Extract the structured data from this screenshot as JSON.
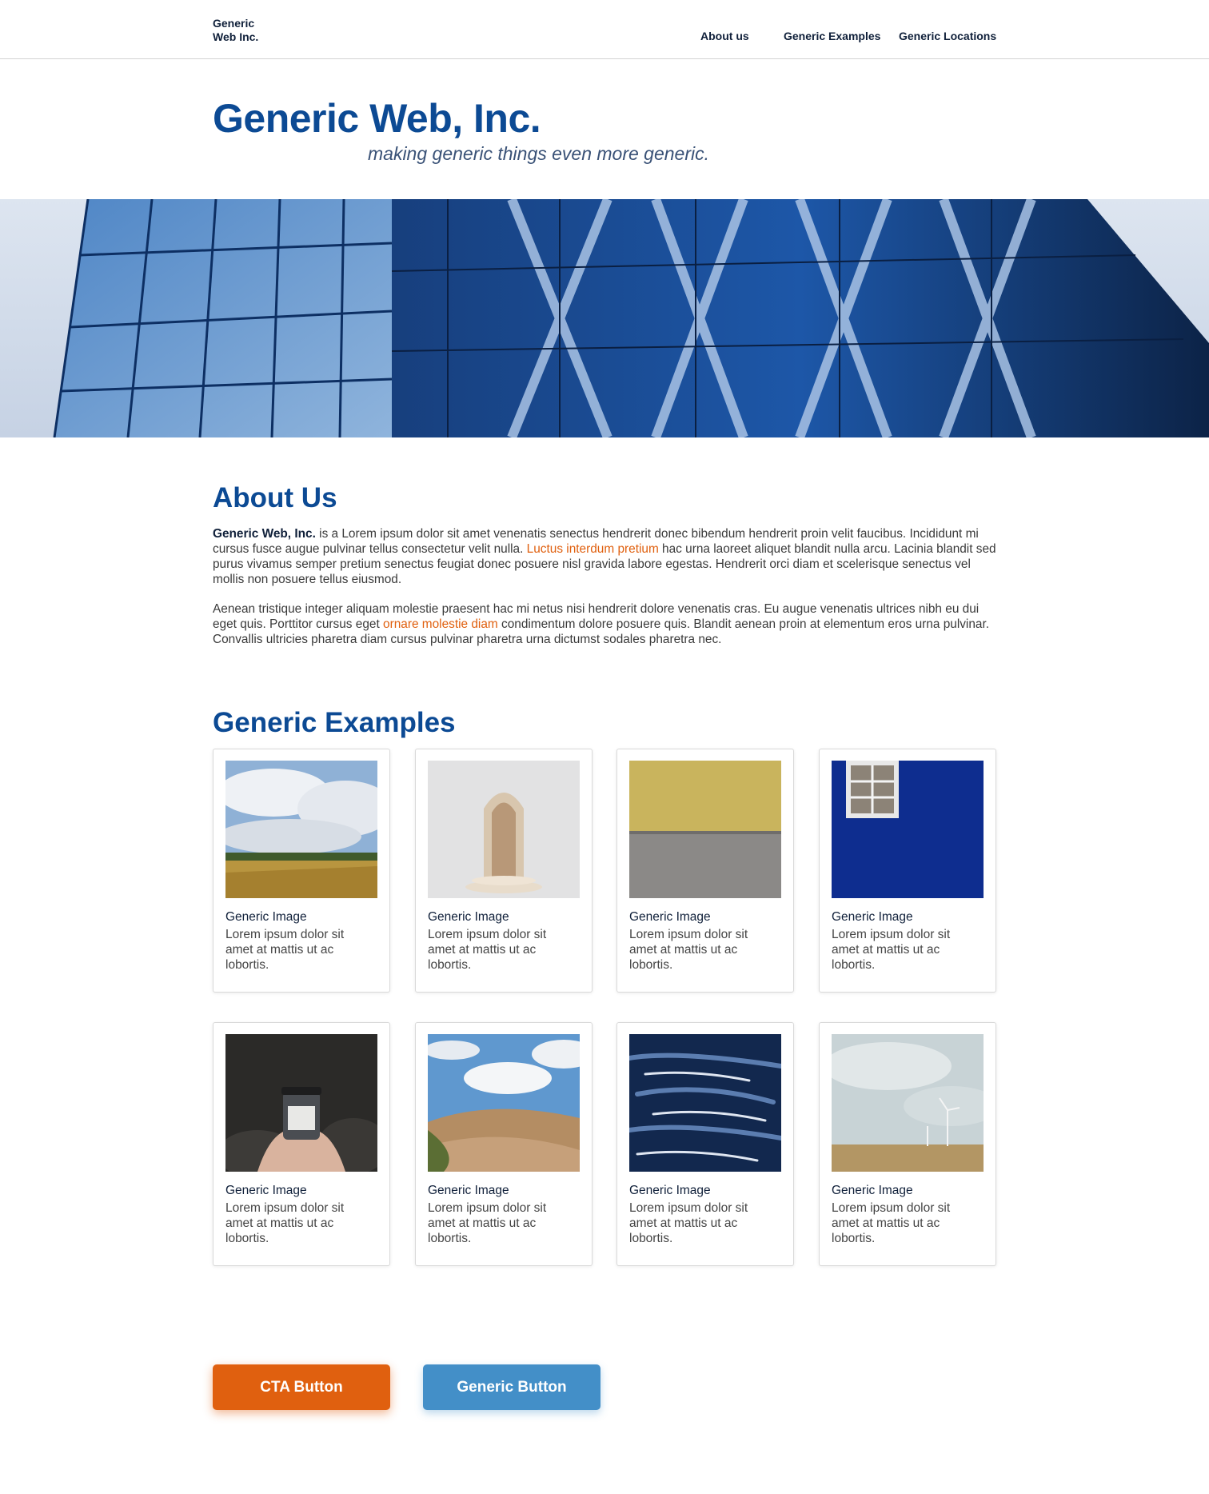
{
  "header": {
    "logo_line1": "Generic",
    "logo_line2": "Web Inc.",
    "nav": [
      {
        "label": "About us"
      },
      {
        "label": "Generic Examples"
      },
      {
        "label": "Generic Locations"
      }
    ]
  },
  "hero": {
    "title": "Generic Web, Inc.",
    "tagline": "making generic things even more generic."
  },
  "about": {
    "heading": "About Us",
    "p1_bold": "Generic Web, Inc.",
    "p1_a": " is a Lorem ipsum dolor sit amet venenatis senectus hendrerit donec bibendum hendrerit proin velit faucibus. Incididunt mi cursus fusce augue pulvinar tellus consectetur velit nulla. ",
    "p1_link": "Luctus interdum pretium",
    "p1_b": " hac urna laoreet aliquet blandit nulla arcu. Lacinia blandit sed purus vivamus semper pretium senectus feugiat donec posuere nisl gravida labore egestas. Hendrerit orci diam et scelerisque senectus vel mollis non posuere tellus eiusmod.",
    "p2_a": "Aenean tristique integer aliquam molestie praesent hac mi netus nisi hendrerit dolore venenatis cras. Eu augue venenatis ultrices nibh eu dui eget quis. Porttitor cursus eget ",
    "p2_link": "ornare molestie diam",
    "p2_b": " condimentum dolore posuere quis. Blandit aenean proin at elementum eros urna pulvinar. Convallis ultricies pharetra diam cursus pulvinar pharetra urna dictumst sodales pharetra nec."
  },
  "examples": {
    "heading": "Generic Examples",
    "cards": [
      {
        "title": "Generic Image",
        "text": "Lorem ipsum dolor sit amet at mattis ut ac lobortis."
      },
      {
        "title": "Generic Image",
        "text": "Lorem ipsum dolor sit amet at mattis ut ac lobortis."
      },
      {
        "title": "Generic Image",
        "text": "Lorem ipsum dolor sit amet at mattis ut ac lobortis."
      },
      {
        "title": "Generic Image",
        "text": "Lorem ipsum dolor sit amet at mattis ut ac lobortis."
      },
      {
        "title": "Generic Image",
        "text": "Lorem ipsum dolor sit amet at mattis ut ac lobortis."
      },
      {
        "title": "Generic Image",
        "text": "Lorem ipsum dolor sit amet at mattis ut ac lobortis."
      },
      {
        "title": "Generic Image",
        "text": "Lorem ipsum dolor sit amet at mattis ut ac lobortis."
      },
      {
        "title": "Generic Image",
        "text": "Lorem ipsum dolor sit amet at mattis ut ac lobortis."
      }
    ]
  },
  "buttons": {
    "cta_label": "CTA Button",
    "generic_label": "Generic Button"
  },
  "colors": {
    "brand_blue": "#0c4a94",
    "accent_orange": "#e0600f",
    "button_blue": "#438fc8"
  }
}
